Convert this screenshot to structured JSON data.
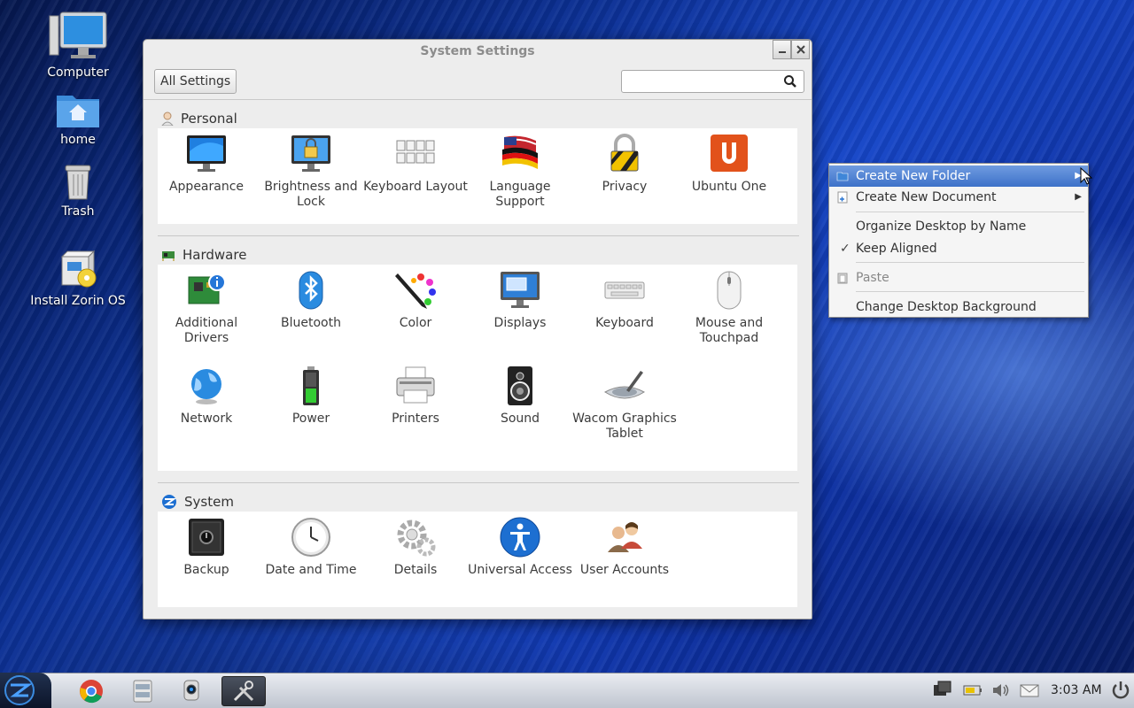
{
  "desktop": {
    "icons": [
      {
        "label": "Computer"
      },
      {
        "label": "home"
      },
      {
        "label": "Trash"
      },
      {
        "label": "Install Zorin OS"
      }
    ]
  },
  "window": {
    "title": "System Settings",
    "all_settings": "All Settings",
    "search_value": "",
    "sections": {
      "personal": {
        "title": "Personal",
        "items": [
          {
            "label": "Appearance"
          },
          {
            "label": "Brightness and Lock"
          },
          {
            "label": "Keyboard Layout"
          },
          {
            "label": "Language Support"
          },
          {
            "label": "Privacy"
          },
          {
            "label": "Ubuntu One"
          }
        ]
      },
      "hardware": {
        "title": "Hardware",
        "items": [
          {
            "label": "Additional Drivers"
          },
          {
            "label": "Bluetooth"
          },
          {
            "label": "Color"
          },
          {
            "label": "Displays"
          },
          {
            "label": "Keyboard"
          },
          {
            "label": "Mouse and Touchpad"
          },
          {
            "label": "Network"
          },
          {
            "label": "Power"
          },
          {
            "label": "Printers"
          },
          {
            "label": "Sound"
          },
          {
            "label": "Wacom Graphics Tablet"
          }
        ]
      },
      "system": {
        "title": "System",
        "items": [
          {
            "label": "Backup"
          },
          {
            "label": "Date and Time"
          },
          {
            "label": "Details"
          },
          {
            "label": "Universal Access"
          },
          {
            "label": "User Accounts"
          }
        ]
      }
    }
  },
  "context_menu": {
    "items": [
      {
        "label": "Create New Folder",
        "highlighted": true,
        "icon": "folder-icon"
      },
      {
        "label": "Create New Document",
        "submenu": true,
        "icon": "new-document-icon"
      },
      {
        "label": "Organize Desktop by Name"
      },
      {
        "label": "Keep Aligned",
        "checked": true
      },
      {
        "label": "Paste",
        "disabled": true,
        "icon": "paste-icon"
      },
      {
        "label": "Change Desktop Background"
      }
    ]
  },
  "panel": {
    "clock": "3:03 AM",
    "tasks": [
      "chrome-icon",
      "file-manager-icon",
      "webcam-icon",
      "system-settings-icon"
    ],
    "tray": [
      "workspace-icon",
      "battery-icon",
      "volume-icon",
      "mail-icon",
      "power-icon"
    ]
  },
  "colors": {
    "menu_highlight": "#4a7fd4",
    "desktop_blue": "#1646c8"
  }
}
